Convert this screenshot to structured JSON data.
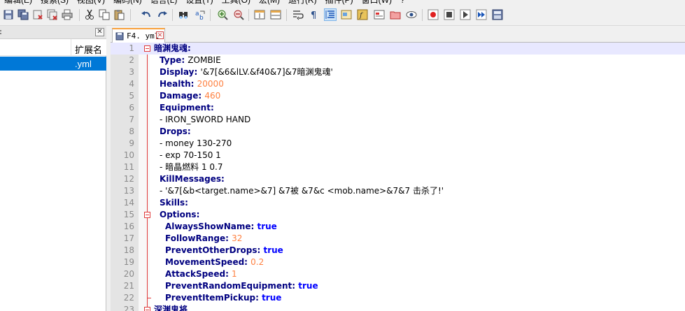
{
  "menubar": {
    "items": [
      "编辑(E)",
      "搜索(S)",
      "视图(V)",
      "编码(N)",
      "语言(L)",
      "设置(T)",
      "工具(O)",
      "宏(M)",
      "运行(R)",
      "插件(P)",
      "窗口(W)",
      "?"
    ]
  },
  "left_panel": {
    "column_ext_header": "扩展名",
    "selected_row_ext": ".yml"
  },
  "tab": {
    "label": "F4. yml"
  },
  "editor": {
    "lines": [
      {
        "n": "1",
        "indent": 0,
        "key": "暗渊鬼魂",
        "sep": ":",
        "val": "",
        "vt": "",
        "fold": "open",
        "current": true
      },
      {
        "n": "2",
        "indent": 2,
        "key": "Type",
        "sep": ": ",
        "val": "ZOMBIE",
        "vt": "v"
      },
      {
        "n": "3",
        "indent": 2,
        "key": "Display",
        "sep": ": ",
        "val": "'&7[&6&lLV.&f40&7]&7暗渊鬼魂'",
        "vt": "v"
      },
      {
        "n": "4",
        "indent": 2,
        "key": "Health",
        "sep": ": ",
        "val": "20000",
        "vt": "n"
      },
      {
        "n": "5",
        "indent": 2,
        "key": "Damage",
        "sep": ": ",
        "val": "460",
        "vt": "n"
      },
      {
        "n": "6",
        "indent": 2,
        "key": "Equipment",
        "sep": ":",
        "val": "",
        "vt": ""
      },
      {
        "n": "7",
        "indent": 2,
        "key": "",
        "sep": "",
        "val": "- IRON_SWORD HAND",
        "vt": "v"
      },
      {
        "n": "8",
        "indent": 2,
        "key": "Drops",
        "sep": ":",
        "val": "",
        "vt": ""
      },
      {
        "n": "9",
        "indent": 2,
        "key": "",
        "sep": "",
        "val": "- money 130-270",
        "vt": "v"
      },
      {
        "n": "10",
        "indent": 2,
        "key": "",
        "sep": "",
        "val": "- exp 70-150 1",
        "vt": "v"
      },
      {
        "n": "11",
        "indent": 2,
        "key": "",
        "sep": "",
        "val": "- 暗晶燃料 1 0.7",
        "vt": "v"
      },
      {
        "n": "12",
        "indent": 2,
        "key": "KillMessages",
        "sep": ":",
        "val": "",
        "vt": ""
      },
      {
        "n": "13",
        "indent": 2,
        "key": "",
        "sep": "",
        "val": "- '&7[&b<target.name>&7] &7被 &7&c <mob.name>&7&7 击杀了!'",
        "vt": "v"
      },
      {
        "n": "14",
        "indent": 2,
        "key": "Skills",
        "sep": ":",
        "val": "",
        "vt": ""
      },
      {
        "n": "15",
        "indent": 2,
        "key": "Options",
        "sep": ":",
        "val": "",
        "vt": "",
        "fold": "open"
      },
      {
        "n": "16",
        "indent": 4,
        "key": "AlwaysShowName",
        "sep": ": ",
        "val": "true",
        "vt": "b"
      },
      {
        "n": "17",
        "indent": 4,
        "key": "FollowRange",
        "sep": ": ",
        "val": "32",
        "vt": "n"
      },
      {
        "n": "18",
        "indent": 4,
        "key": "PreventOtherDrops",
        "sep": ": ",
        "val": "true",
        "vt": "b"
      },
      {
        "n": "19",
        "indent": 4,
        "key": "MovementSpeed",
        "sep": ": ",
        "val": "0.2",
        "vt": "n"
      },
      {
        "n": "20",
        "indent": 4,
        "key": "AttackSpeed",
        "sep": ": ",
        "val": "1",
        "vt": "n"
      },
      {
        "n": "21",
        "indent": 4,
        "key": "PreventRandomEquipment",
        "sep": ": ",
        "val": "true",
        "vt": "b"
      },
      {
        "n": "22",
        "indent": 4,
        "key": "PreventItemPickup",
        "sep": ": ",
        "val": "true",
        "vt": "b",
        "fold": "end"
      },
      {
        "n": "23",
        "indent": 0,
        "key": "深渊鬼将",
        "sep": "",
        "val": "",
        "vt": "",
        "fold": "open"
      }
    ]
  },
  "toolbar": {
    "icons": [
      "save-icon",
      "save-all-icon",
      "close-icon",
      "close-all-icon",
      "print-icon",
      "cut-icon",
      "copy-icon",
      "paste-icon",
      "undo-icon",
      "redo-icon",
      "find-icon",
      "replace-icon",
      "zoom-in-icon",
      "zoom-out-icon",
      "sync-vertical-icon",
      "sync-horizontal-icon",
      "word-wrap-icon",
      "show-all-chars-icon",
      "indent-guide-icon",
      "doc-map-icon",
      "function-list-icon",
      "folder-workspace-icon",
      "monitor-icon",
      "record-macro-icon",
      "stop-record-icon",
      "play-macro-icon",
      "run-macro-multiple-icon",
      "save-macro-icon"
    ]
  }
}
